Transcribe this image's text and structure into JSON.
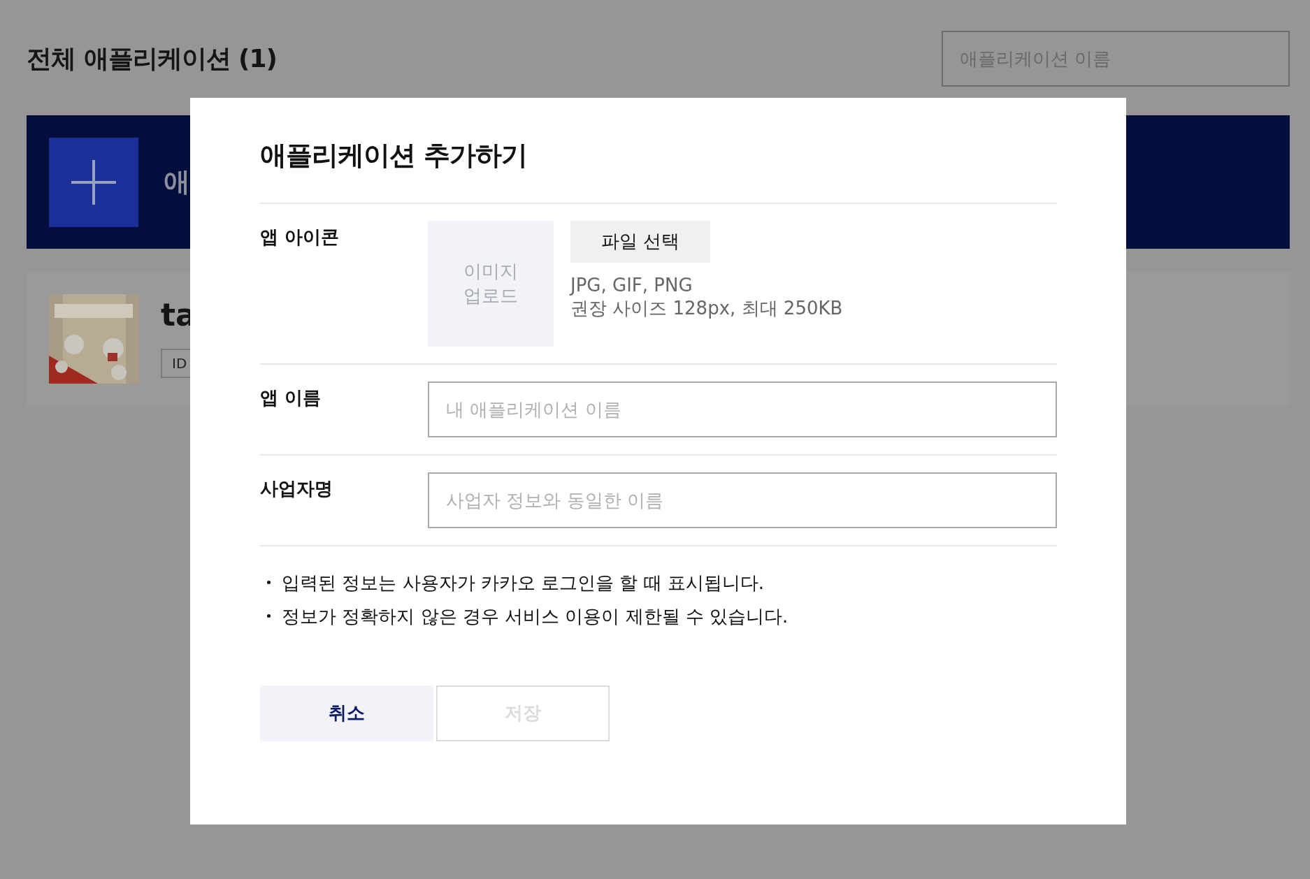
{
  "page": {
    "title": "전체 애플리케이션 (1)",
    "search": {
      "placeholder": "애플리케이션 이름"
    },
    "banner": {
      "text": "애"
    },
    "apps": [
      {
        "name": "ta",
        "id_label": "ID"
      }
    ]
  },
  "dialog": {
    "title": "애플리케이션 추가하기",
    "icon_row": {
      "label": "앱 아이콘",
      "upload_text": "이미지\n업로드",
      "file_button": "파일 선택",
      "hints": [
        "JPG, GIF, PNG",
        "권장 사이즈 128px, 최대 250KB"
      ]
    },
    "fields": [
      {
        "label": "앱 이름",
        "placeholder": "내 애플리케이션 이름"
      },
      {
        "label": "사업자명",
        "placeholder": "사업자 정보와 동일한 이름"
      }
    ],
    "notes": [
      "입력된 정보는 사용자가 카카오 로그인을 할 때 표시됩니다.",
      "정보가 정확하지 않은 경우 서비스 이용이 제한될 수 있습니다."
    ],
    "buttons": [
      {
        "label": "취소",
        "kind": "cancel",
        "disabled": false
      },
      {
        "label": "저장",
        "kind": "save",
        "disabled": true
      }
    ]
  }
}
